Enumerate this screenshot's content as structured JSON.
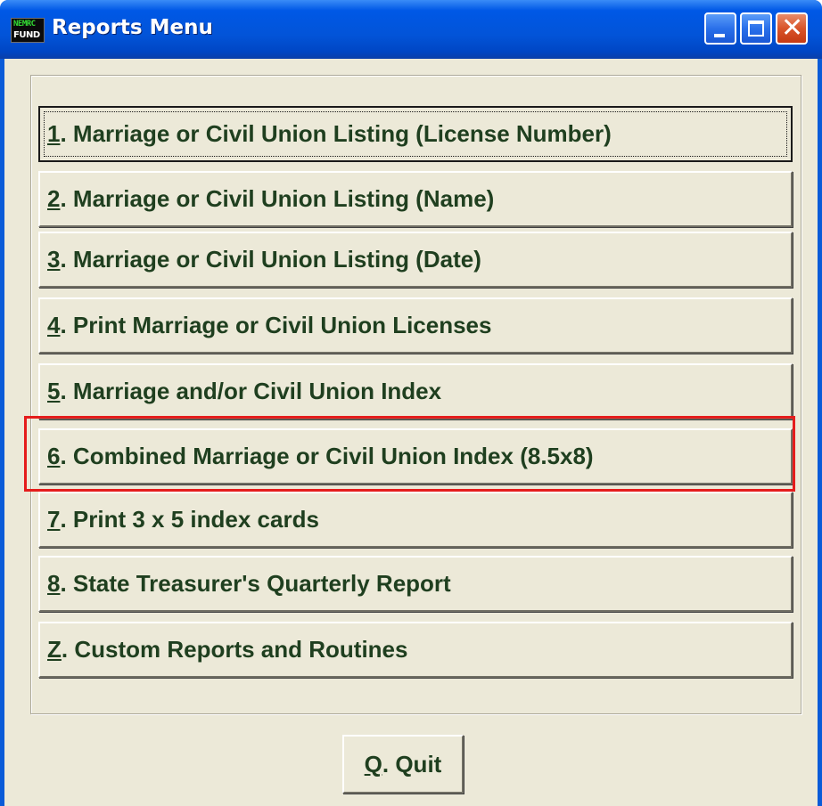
{
  "window": {
    "title": "Reports Menu",
    "icon_text_top": "NEMRC",
    "icon_text_bottom": "FUND",
    "controls": [
      "minimize-icon",
      "maximize-icon",
      "close-icon"
    ]
  },
  "menu": {
    "items": [
      {
        "key": "1",
        "label": ". Marriage or Civil Union Listing (License Number)",
        "focused": true
      },
      {
        "key": "2",
        "label": ". Marriage or Civil Union Listing (Name)"
      },
      {
        "key": "3",
        "label": ". Marriage or Civil Union Listing (Date)"
      },
      {
        "key": "4",
        "label": ". Print Marriage or Civil Union Licenses"
      },
      {
        "key": "5",
        "label": ". Marriage and/or Civil Union Index"
      },
      {
        "key": "6",
        "label": ". Combined Marriage or Civil Union Index (8.5x8)",
        "highlighted": true
      },
      {
        "key": "7",
        "label": ". Print 3 x 5 index cards"
      },
      {
        "key": "8",
        "label": ". State Treasurer's Quarterly Report"
      },
      {
        "key": "Z",
        "label": ".  Custom Reports and Routines"
      }
    ]
  },
  "quit": {
    "key": "Q",
    "label": ".  Quit"
  },
  "colors": {
    "titlebar": "#0054e3",
    "client_bg": "#ece9d8",
    "button_text": "#1f3f1f",
    "highlight_border": "#e51c1c"
  }
}
